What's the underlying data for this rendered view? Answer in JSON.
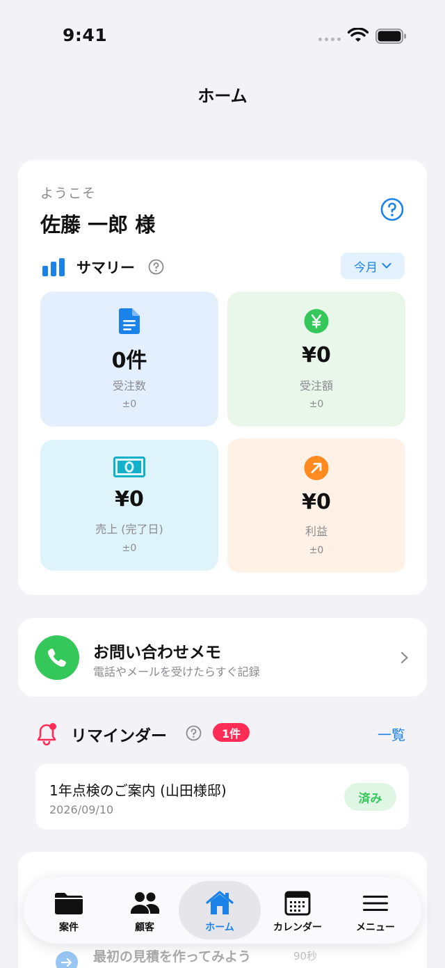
{
  "status_bar": {
    "time": "9:41"
  },
  "nav": {
    "title": "ホーム"
  },
  "welcome": {
    "greeting": "ようこそ",
    "user_name": "佐藤 一郎 様"
  },
  "summary": {
    "title": "サマリー",
    "period": "今月",
    "tiles": [
      {
        "value": "0件",
        "label": "受注数",
        "delta": "±0",
        "icon": "document-icon",
        "color": "#1a82e8"
      },
      {
        "value": "¥0",
        "label": "受注額",
        "delta": "±0",
        "icon": "yen-icon",
        "color": "#34c759"
      },
      {
        "value": "¥0",
        "label": "売上 (完了日)",
        "delta": "±0",
        "icon": "banknote-icon",
        "color": "#12b0c9"
      },
      {
        "value": "¥0",
        "label": "利益",
        "delta": "±0",
        "icon": "trend-up-icon",
        "color": "#ff8a1f"
      }
    ]
  },
  "memo": {
    "title": "お問い合わせメモ",
    "subtitle": "電話やメールを受けたらすぐ記録"
  },
  "reminders": {
    "title": "リマインダー",
    "count": "1件",
    "list_link": "一覧",
    "items": [
      {
        "title": "1年点検のご案内 (山田様邸)",
        "date": "2026/09/10",
        "action": "済み"
      }
    ]
  },
  "onboarding": {
    "text": "最初の見積を作ってみよう",
    "time": "90秒"
  },
  "tab_bar": {
    "tabs": [
      {
        "label": "案件",
        "icon": "folder-icon"
      },
      {
        "label": "顧客",
        "icon": "people-icon"
      },
      {
        "label": "ホーム",
        "icon": "home-icon"
      },
      {
        "label": "カレンダー",
        "icon": "calendar-icon"
      },
      {
        "label": "メニュー",
        "icon": "menu-icon"
      }
    ],
    "active": "ホーム"
  },
  "colors": {
    "accent": "#1a82e8",
    "success": "#34c759",
    "badge": "#ff2d55",
    "background": "#f2f2f7"
  }
}
